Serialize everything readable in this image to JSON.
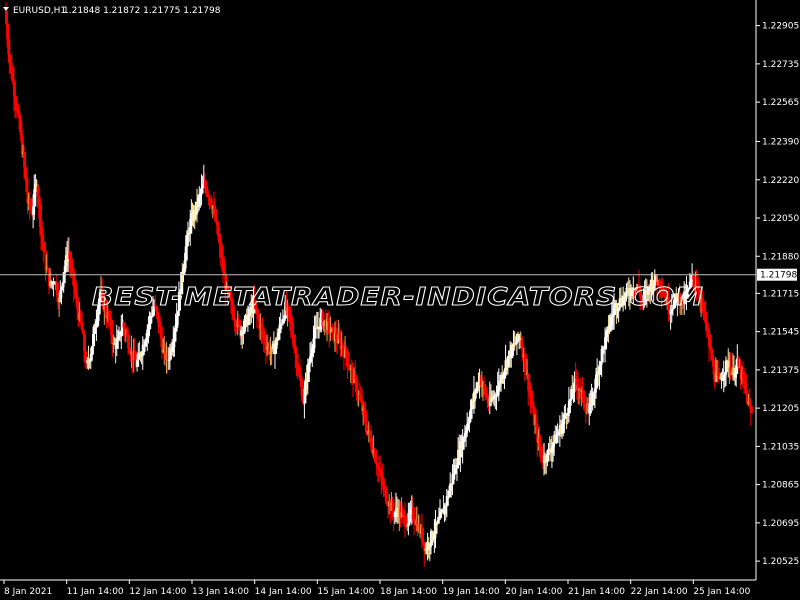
{
  "header": {
    "symbol": "EURUSD,H1",
    "ohlc": "1.21848 1.21872 1.21775 1.21798"
  },
  "watermark": {
    "text": "BEST-METATRADER-INDICATORS.COM"
  },
  "colors": {
    "background": "#000000",
    "bull": "#ffffff",
    "bear": "#ff0000",
    "neutral_bull": "#ffe4a0",
    "neutral_bear": "#e8a050",
    "axis": "#ffffff",
    "price_line": "#c0c0c0"
  },
  "chart_data": {
    "type": "candlestick",
    "title": "",
    "ylim": [
      1.2045,
      1.2301
    ],
    "y_ticks": [
      "1.22905",
      "1.22735",
      "1.22565",
      "1.22390",
      "1.22220",
      "1.22050",
      "1.21880",
      "1.21715",
      "1.21545",
      "1.21375",
      "1.21205",
      "1.21035",
      "1.20865",
      "1.20695",
      "1.20525"
    ],
    "x_ticks": [
      "8 Jan 2021",
      "11 Jan 14:00",
      "12 Jan 14:00",
      "13 Jan 14:00",
      "14 Jan 14:00",
      "15 Jan 14:00",
      "18 Jan 14:00",
      "19 Jan 14:00",
      "20 Jan 14:00",
      "21 Jan 14:00",
      "22 Jan 14:00",
      "25 Jan 14:00"
    ],
    "current_price": "1.21798",
    "grid": false,
    "series_path": [
      1.2297,
      1.2275,
      1.2262,
      1.2248,
      1.2232,
      1.2212,
      1.2208,
      1.2222,
      1.2198,
      1.2184,
      1.2175,
      1.2178,
      1.2168,
      1.2182,
      1.219,
      1.2178,
      1.2165,
      1.2155,
      1.2138,
      1.2146,
      1.2158,
      1.2172,
      1.2165,
      1.216,
      1.2148,
      1.215,
      1.2158,
      1.2152,
      1.2145,
      1.214,
      1.2145,
      1.2152,
      1.216,
      1.2166,
      1.2158,
      1.2145,
      1.2142,
      1.215,
      1.2162,
      1.2178,
      1.2192,
      1.2203,
      1.2208,
      1.2214,
      1.222,
      1.2216,
      1.221,
      1.2198,
      1.2185,
      1.2172,
      1.2166,
      1.216,
      1.2155,
      1.2158,
      1.2162,
      1.2166,
      1.216,
      1.2152,
      1.2148,
      1.2145,
      1.215,
      1.2158,
      1.2165,
      1.216,
      1.2148,
      1.2135,
      1.2124,
      1.2138,
      1.215,
      1.2156,
      1.216,
      1.2158,
      1.2155,
      1.2152,
      1.215,
      1.2146,
      1.214,
      1.2134,
      1.2128,
      1.212,
      1.2112,
      1.2105,
      1.2098,
      1.209,
      1.2083,
      1.2078,
      1.2074,
      1.2075,
      1.2072,
      1.207,
      1.2074,
      1.207,
      1.2065,
      1.2058,
      1.2062,
      1.2066,
      1.207,
      1.2075,
      1.2082,
      1.209,
      1.2098,
      1.2105,
      1.2112,
      1.212,
      1.2128,
      1.2134,
      1.2128,
      1.2122,
      1.2125,
      1.213,
      1.2136,
      1.2142,
      1.2146,
      1.215,
      1.2152,
      1.214,
      1.2128,
      1.2115,
      1.2105,
      1.2098,
      1.21,
      1.2104,
      1.2108,
      1.2112,
      1.2118,
      1.2124,
      1.2132,
      1.213,
      1.2124,
      1.2118,
      1.2126,
      1.2136,
      1.2145,
      1.2152,
      1.216,
      1.2166,
      1.2168,
      1.217,
      1.2172,
      1.2175,
      1.2174,
      1.2168,
      1.2172,
      1.2176,
      1.2177,
      1.2176,
      1.217,
      1.2165,
      1.2168,
      1.217,
      1.2168,
      1.2172,
      1.2178,
      1.2176,
      1.2168,
      1.2158,
      1.2145,
      1.2135,
      1.2132,
      1.2138,
      1.214,
      1.2136,
      1.214,
      1.2134,
      1.2126,
      1.2118
    ]
  }
}
